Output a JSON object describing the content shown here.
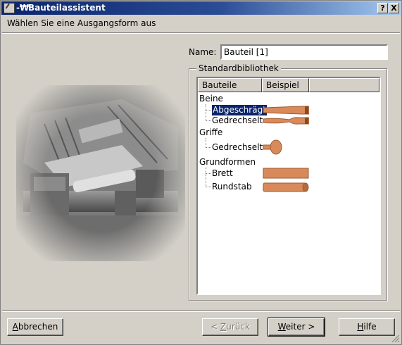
{
  "window": {
    "title": "Bauteilassistent",
    "title_symbol": "-₩",
    "help_button": "?",
    "close_button": "X"
  },
  "header": {
    "instruction": "Wählen Sie eine Ausgangsform aus"
  },
  "form": {
    "name_label": "Name:",
    "name_value": "Bauteil [1]"
  },
  "library": {
    "group_title": "Standardbibliothek",
    "columns": [
      "Bauteile",
      "Beispiel"
    ],
    "tree": [
      {
        "label": "Beine",
        "children": [
          {
            "label": "Abgeschrägt",
            "preview": "tapered-leg",
            "selected": true
          },
          {
            "label": "Gedrechselt",
            "preview": "turned-leg",
            "selected": false
          }
        ]
      },
      {
        "label": "Griffe",
        "children": [
          {
            "label": "Gedrechselt",
            "preview": "knob",
            "selected": false
          }
        ]
      },
      {
        "label": "Grundformen",
        "children": [
          {
            "label": "Brett",
            "preview": "board",
            "selected": false
          },
          {
            "label": "Rundstab",
            "preview": "round-rod",
            "selected": false
          }
        ]
      }
    ]
  },
  "buttons": {
    "cancel": {
      "prefix": "",
      "mnemonic": "A",
      "rest": "bbrechen"
    },
    "back": {
      "prefix": "< ",
      "mnemonic": "Z",
      "rest": "urück"
    },
    "next": {
      "prefix": "",
      "mnemonic": "W",
      "rest": "eiter >"
    },
    "help": {
      "prefix": "",
      "mnemonic": "H",
      "rest": "ilfe"
    }
  },
  "colors": {
    "window_bg": "#d4d0c8",
    "title_gradient_start": "#0a246a",
    "title_gradient_end": "#a6caf0",
    "selection": "#0a246a",
    "wood": "#d98a5a"
  }
}
